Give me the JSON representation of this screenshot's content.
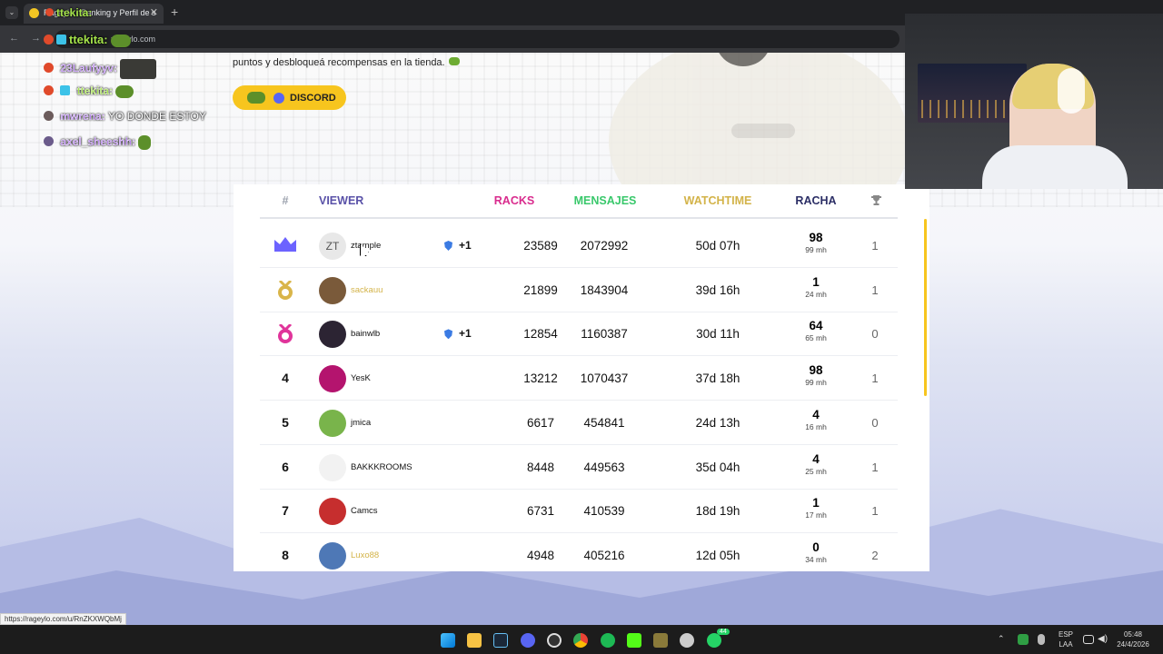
{
  "browser": {
    "tab_title": "Rageylo - Ranking y Perfil de s",
    "address": "rageylo.com",
    "status_url": "https://rageylo.com/u/RnZKXWQbMj"
  },
  "chat": {
    "overlay_top": "ttekita:",
    "messages": [
      {
        "user": "ttekita:",
        "text": ""
      },
      {
        "user": "23Laufyyv:",
        "text": ""
      },
      {
        "user": "ttekita:",
        "text": ""
      },
      {
        "user": "mwrena:",
        "text": "YO DONDE ESTOY"
      },
      {
        "user": "axel_sheeshh:",
        "text": ""
      }
    ]
  },
  "promo": {
    "text": "puntos y desbloqueá recompensas en la tienda.",
    "discord_label": "DISCORD"
  },
  "leaderboard": {
    "headers": {
      "rank": "#",
      "viewer": "VIEWER",
      "racks": "RACKS",
      "mensajes": "MENSAJES",
      "watchtime": "WATCHTIME",
      "racha": "RACHA"
    },
    "header_colors": {
      "rank": "#9aa0ac",
      "viewer": "#5a52a8",
      "racks": "#d92b8d",
      "mensajes": "#39c86b",
      "watchtime": "#d3b349",
      "racha": "#2c2f66"
    },
    "rows": [
      {
        "rank": "",
        "medal": "crown",
        "avatar_text": "ZT",
        "name": "ztample",
        "name_color": "default",
        "badge": "+1",
        "racks": "23589",
        "mensajes": "2072992",
        "watchtime": "50d 07h",
        "racha": "98",
        "racha_sub": "99 mh",
        "trophies": "1"
      },
      {
        "rank": "",
        "medal": "gold-medal",
        "avatar_text": "",
        "name": "sackauu",
        "name_color": "gold",
        "badge": "",
        "racks": "21899",
        "mensajes": "1843904",
        "watchtime": "39d 16h",
        "racha": "1",
        "racha_sub": "24 mh",
        "trophies": "1"
      },
      {
        "rank": "",
        "medal": "pink-medal",
        "avatar_text": "",
        "name": "bainwlb",
        "name_color": "default",
        "badge": "+1",
        "racks": "12854",
        "mensajes": "1160387",
        "watchtime": "30d 11h",
        "racha": "64",
        "racha_sub": "65 mh",
        "trophies": "0"
      },
      {
        "rank": "4",
        "medal": "",
        "avatar_text": "",
        "name": "YesK",
        "name_color": "default",
        "badge": "",
        "racks": "13212",
        "mensajes": "1070437",
        "watchtime": "37d 18h",
        "racha": "98",
        "racha_sub": "99 mh",
        "trophies": "1"
      },
      {
        "rank": "5",
        "medal": "",
        "avatar_text": "",
        "name": "jmica",
        "name_color": "default",
        "badge": "",
        "racks": "6617",
        "mensajes": "454841",
        "watchtime": "24d 13h",
        "racha": "4",
        "racha_sub": "16 mh",
        "trophies": "0"
      },
      {
        "rank": "6",
        "medal": "",
        "avatar_text": "",
        "name": "BAKKKROOMS",
        "name_color": "default",
        "badge": "",
        "racks": "8448",
        "mensajes": "449563",
        "watchtime": "35d 04h",
        "racha": "4",
        "racha_sub": "25 mh",
        "trophies": "1"
      },
      {
        "rank": "7",
        "medal": "",
        "avatar_text": "",
        "name": "Camcs",
        "name_color": "default",
        "badge": "",
        "racks": "6731",
        "mensajes": "410539",
        "watchtime": "18d 19h",
        "racha": "1",
        "racha_sub": "17 mh",
        "trophies": "1"
      },
      {
        "rank": "8",
        "medal": "",
        "avatar_text": "",
        "name": "Luxo88",
        "name_color": "gold",
        "badge": "",
        "racks": "4948",
        "mensajes": "405216",
        "watchtime": "12d 05h",
        "racha": "0",
        "racha_sub": "34 mh",
        "trophies": "2"
      }
    ],
    "avatar_colors": [
      "#e8e8e8",
      "#7a5a3a",
      "#2c2433",
      "#b4146e",
      "#79b44b",
      "#f2f2f2",
      "#c62e2e",
      "#4e78b6"
    ]
  },
  "taskbar": {
    "lang": "ESP",
    "lang_sub": "LAA",
    "time": "05:48",
    "date": "24/4/2026",
    "whatsapp_badge": "44"
  },
  "colors": {
    "accent": "#f7c51e",
    "discord": "#5865f2"
  }
}
